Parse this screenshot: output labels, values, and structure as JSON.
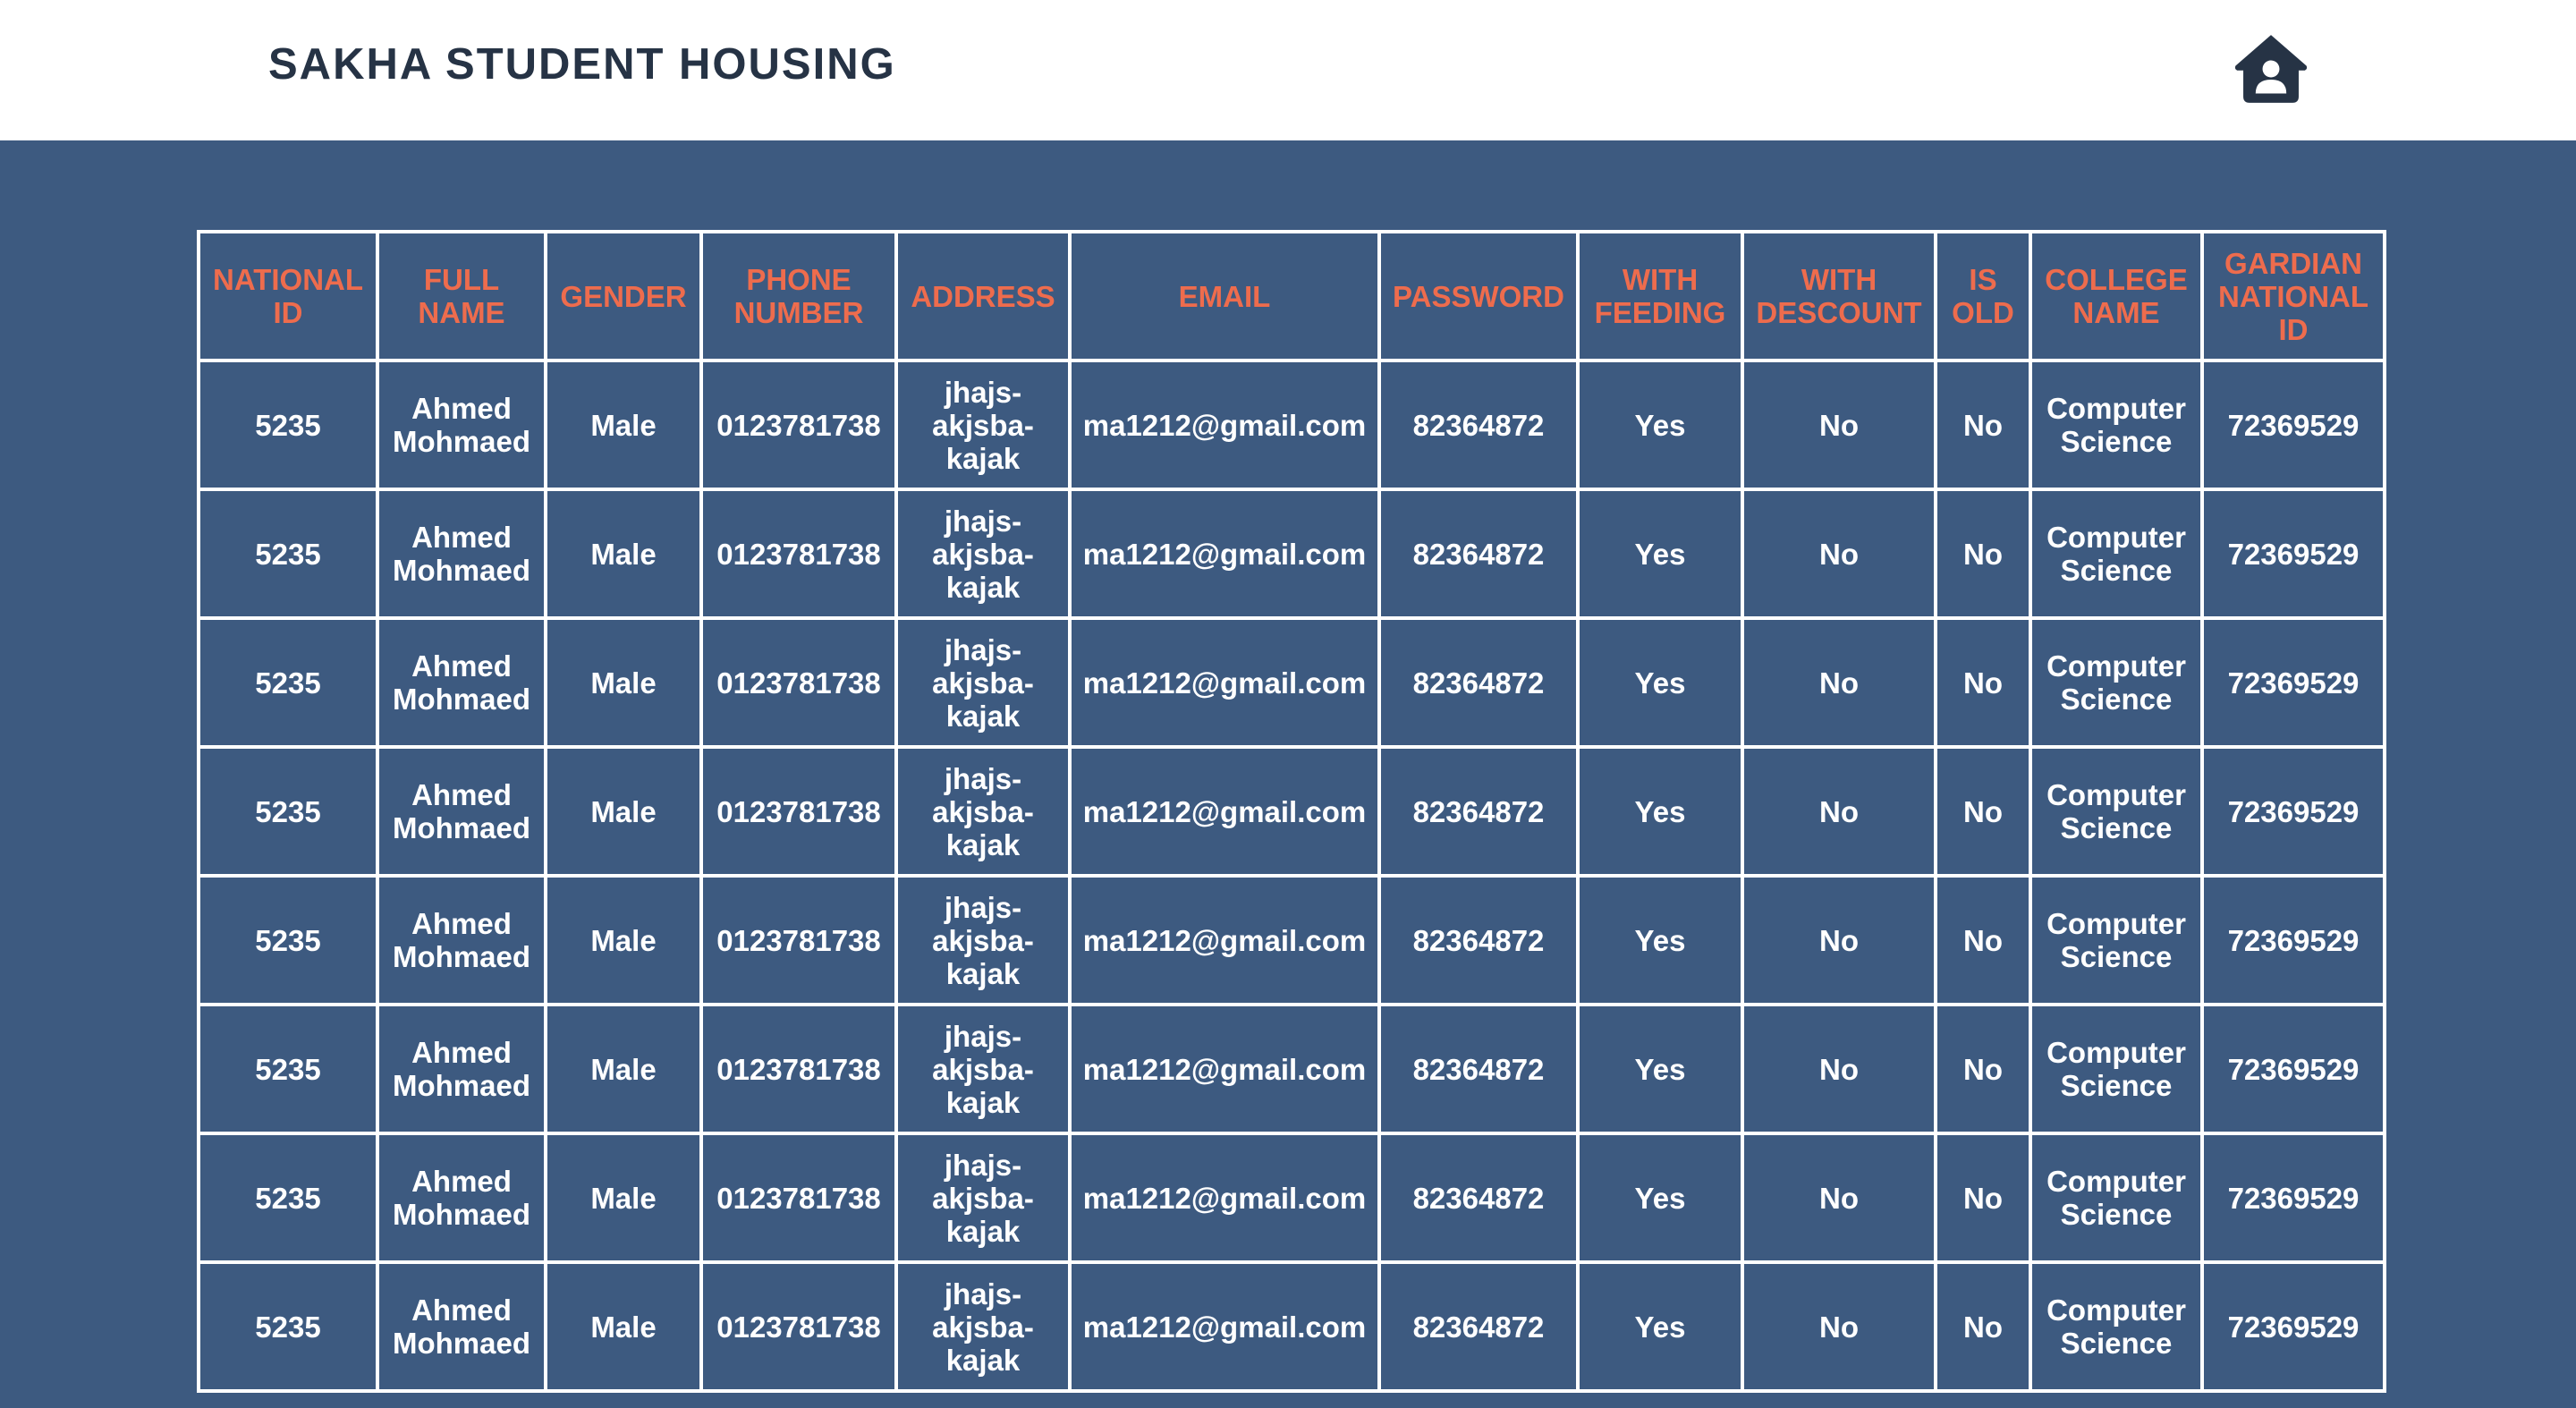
{
  "header": {
    "title": "SAKHA STUDENT HOUSING",
    "home_icon": "home-user-icon"
  },
  "colors": {
    "background": "#3d5a80",
    "header_bg": "#ffffff",
    "title_text": "#263345",
    "column_header_text": "#ee6c4d",
    "cell_text": "#ffffff",
    "grid_lines": "#ffffff"
  },
  "table": {
    "columns": [
      "NATIONAL ID",
      "FULL NAME",
      "GENDER",
      "PHONE NUMBER",
      "ADDRESS",
      "EMAIL",
      "PASSWORD",
      "WITH FEEDING",
      "WITH DESCOUNT",
      "IS OLD",
      "COLLEGE NAME",
      "GARDIAN NATIONAL ID"
    ],
    "rows": [
      [
        "5235",
        "Ahmed Mohmaed",
        "Male",
        "0123781738",
        "jhajs-akjsba-kajak",
        "ma1212@gmail.com",
        "82364872",
        "Yes",
        "No",
        "No",
        "Computer Science",
        "72369529"
      ],
      [
        "5235",
        "Ahmed Mohmaed",
        "Male",
        "0123781738",
        "jhajs-akjsba-kajak",
        "ma1212@gmail.com",
        "82364872",
        "Yes",
        "No",
        "No",
        "Computer Science",
        "72369529"
      ],
      [
        "5235",
        "Ahmed Mohmaed",
        "Male",
        "0123781738",
        "jhajs-akjsba-kajak",
        "ma1212@gmail.com",
        "82364872",
        "Yes",
        "No",
        "No",
        "Computer Science",
        "72369529"
      ],
      [
        "5235",
        "Ahmed Mohmaed",
        "Male",
        "0123781738",
        "jhajs-akjsba-kajak",
        "ma1212@gmail.com",
        "82364872",
        "Yes",
        "No",
        "No",
        "Computer Science",
        "72369529"
      ],
      [
        "5235",
        "Ahmed Mohmaed",
        "Male",
        "0123781738",
        "jhajs-akjsba-kajak",
        "ma1212@gmail.com",
        "82364872",
        "Yes",
        "No",
        "No",
        "Computer Science",
        "72369529"
      ],
      [
        "5235",
        "Ahmed Mohmaed",
        "Male",
        "0123781738",
        "jhajs-akjsba-kajak",
        "ma1212@gmail.com",
        "82364872",
        "Yes",
        "No",
        "No",
        "Computer Science",
        "72369529"
      ],
      [
        "5235",
        "Ahmed Mohmaed",
        "Male",
        "0123781738",
        "jhajs-akjsba-kajak",
        "ma1212@gmail.com",
        "82364872",
        "Yes",
        "No",
        "No",
        "Computer Science",
        "72369529"
      ],
      [
        "5235",
        "Ahmed Mohmaed",
        "Male",
        "0123781738",
        "jhajs-akjsba-kajak",
        "ma1212@gmail.com",
        "82364872",
        "Yes",
        "No",
        "No",
        "Computer Science",
        "72369529"
      ]
    ]
  }
}
